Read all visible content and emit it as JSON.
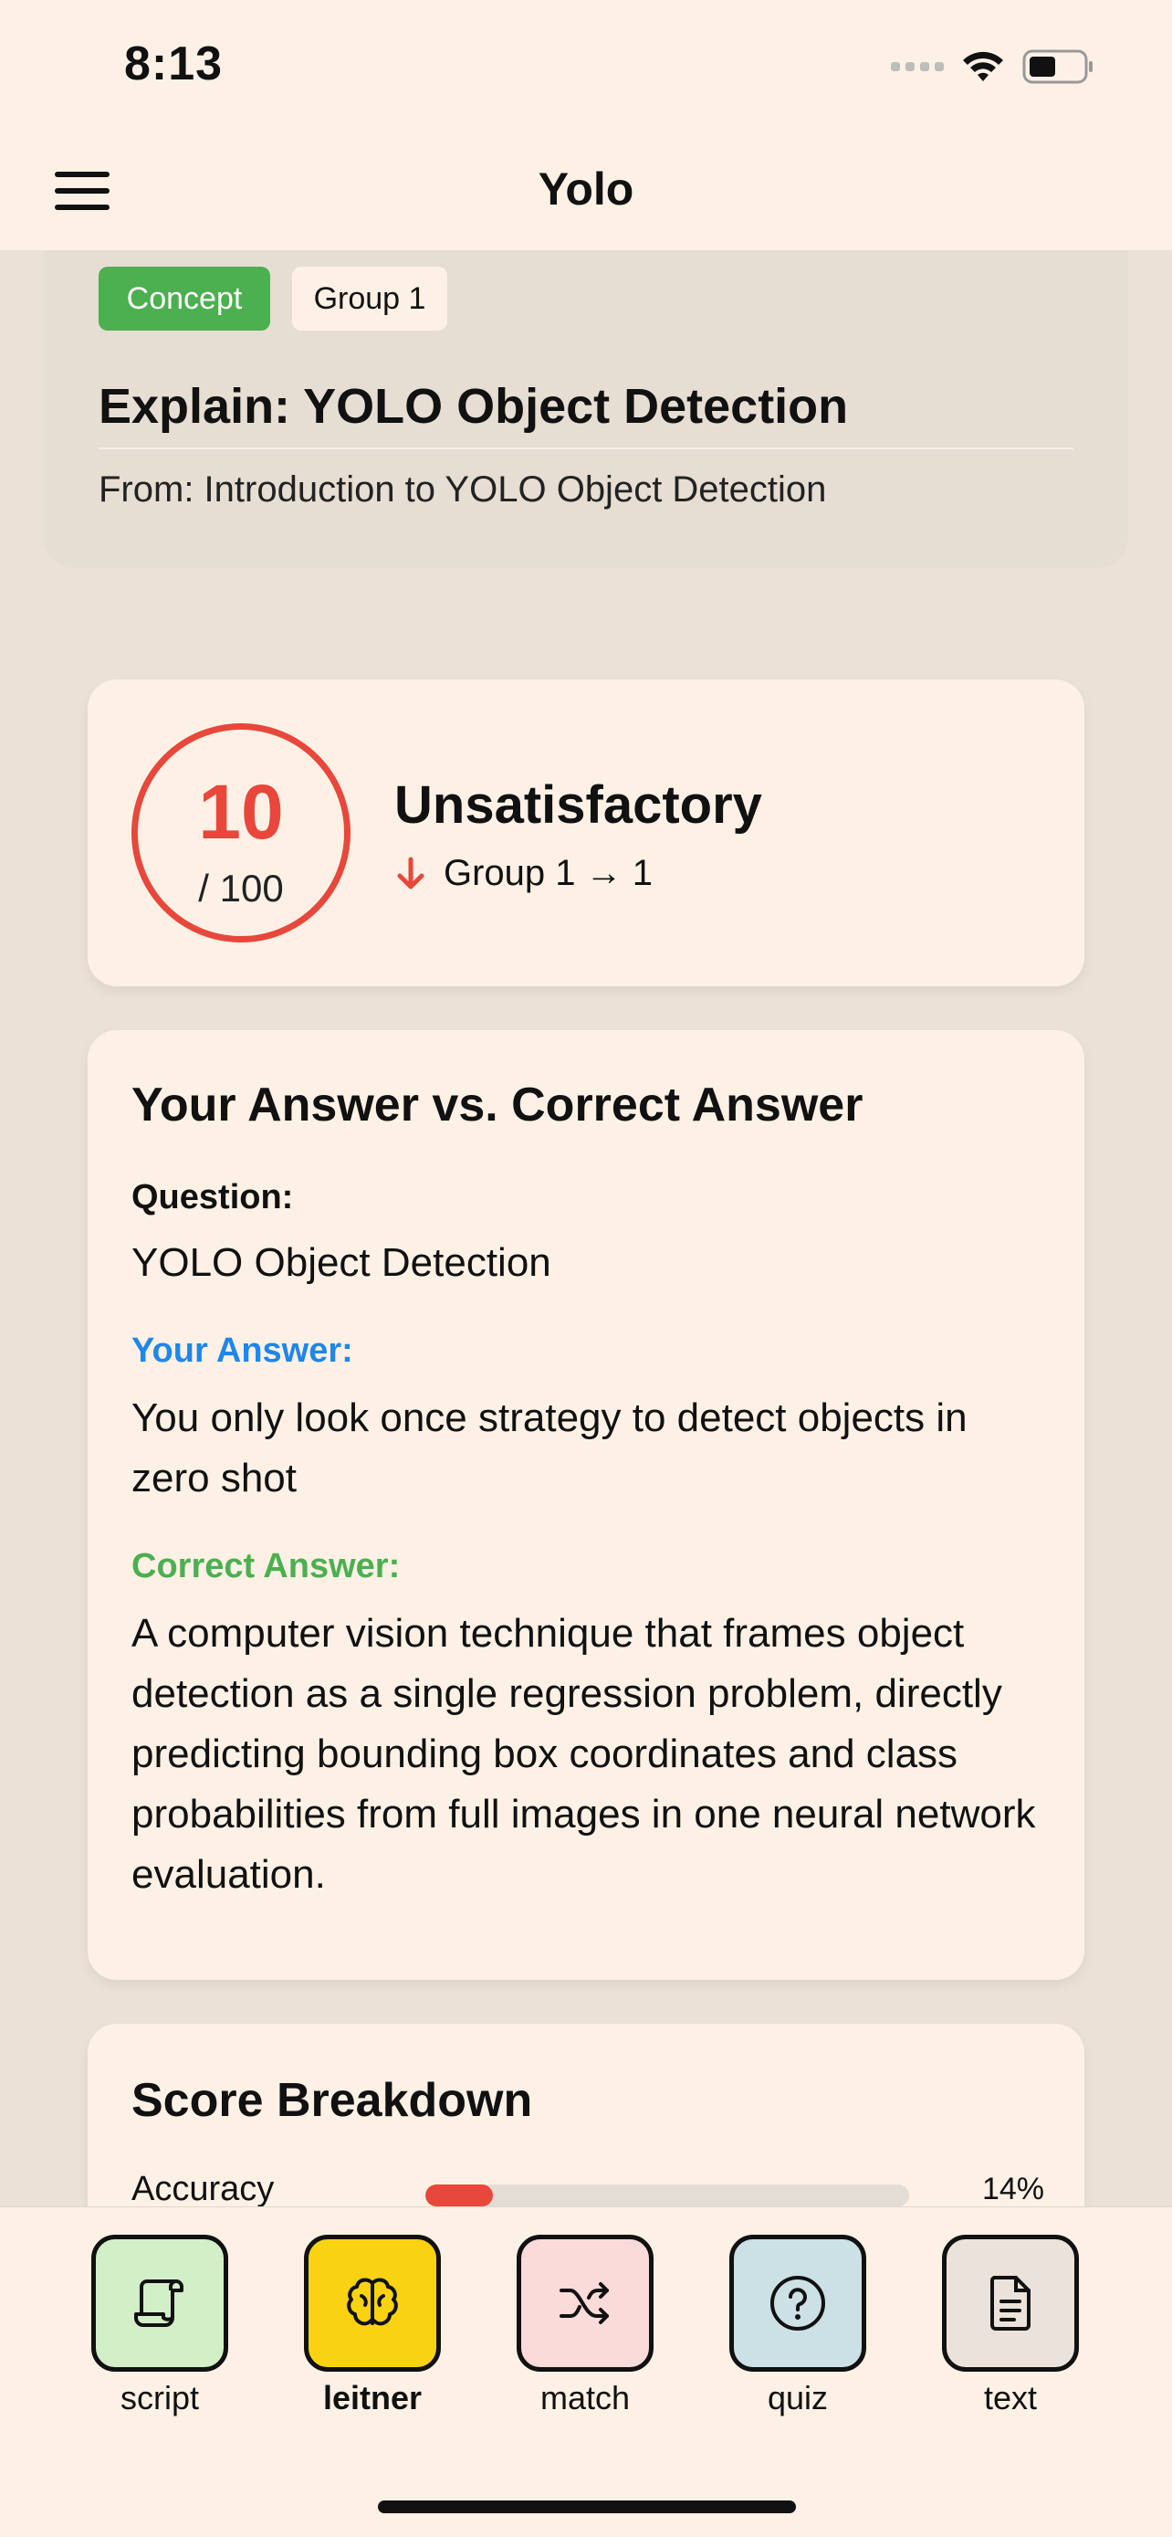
{
  "status_bar": {
    "time": "8:13"
  },
  "header": {
    "title": "Yolo"
  },
  "concept_card": {
    "tag_type": "Concept",
    "tag_group": "Group 1",
    "title": "Explain: YOLO Object Detection",
    "source": "From: Introduction to YOLO Object Detection"
  },
  "score": {
    "value": "10",
    "max": "/ 100",
    "rating": "Unsatisfactory",
    "group_change": "Group 1 → 1"
  },
  "comparison": {
    "heading": "Your Answer vs. Correct Answer",
    "question_label": "Question:",
    "question": "YOLO Object Detection",
    "your_answer_label": "Your Answer:",
    "your_answer": "You only look once strategy to detect objects in zero shot",
    "correct_answer_label": "Correct Answer:",
    "correct_answer": "A computer vision technique that frames object detection as a single regression problem, directly predicting bounding box coordinates and class probabilities from full images in one neural network evaluation."
  },
  "breakdown": {
    "heading": "Score Breakdown",
    "rows": [
      {
        "label": "Accuracy",
        "value": "14%",
        "fraction": 0.14
      }
    ]
  },
  "tabs": [
    {
      "label": "script",
      "icon": "scroll-icon",
      "color": "#d2efc8"
    },
    {
      "label": "leitner",
      "icon": "brain-icon",
      "color": "#f9d312",
      "active": true
    },
    {
      "label": "match",
      "icon": "shuffle-icon",
      "color": "#fbdada"
    },
    {
      "label": "quiz",
      "icon": "question-circle-icon",
      "color": "#cce1e6"
    },
    {
      "label": "text",
      "icon": "document-icon",
      "color": "#ebe3db"
    }
  ],
  "colors": {
    "accent_red": "#e8473c",
    "concept_green": "#4caf50",
    "your_answer_blue": "#1f86ea",
    "correct_answer_green": "#4caf50",
    "background": "#ebe1d6",
    "card": "#fdf1e6"
  }
}
